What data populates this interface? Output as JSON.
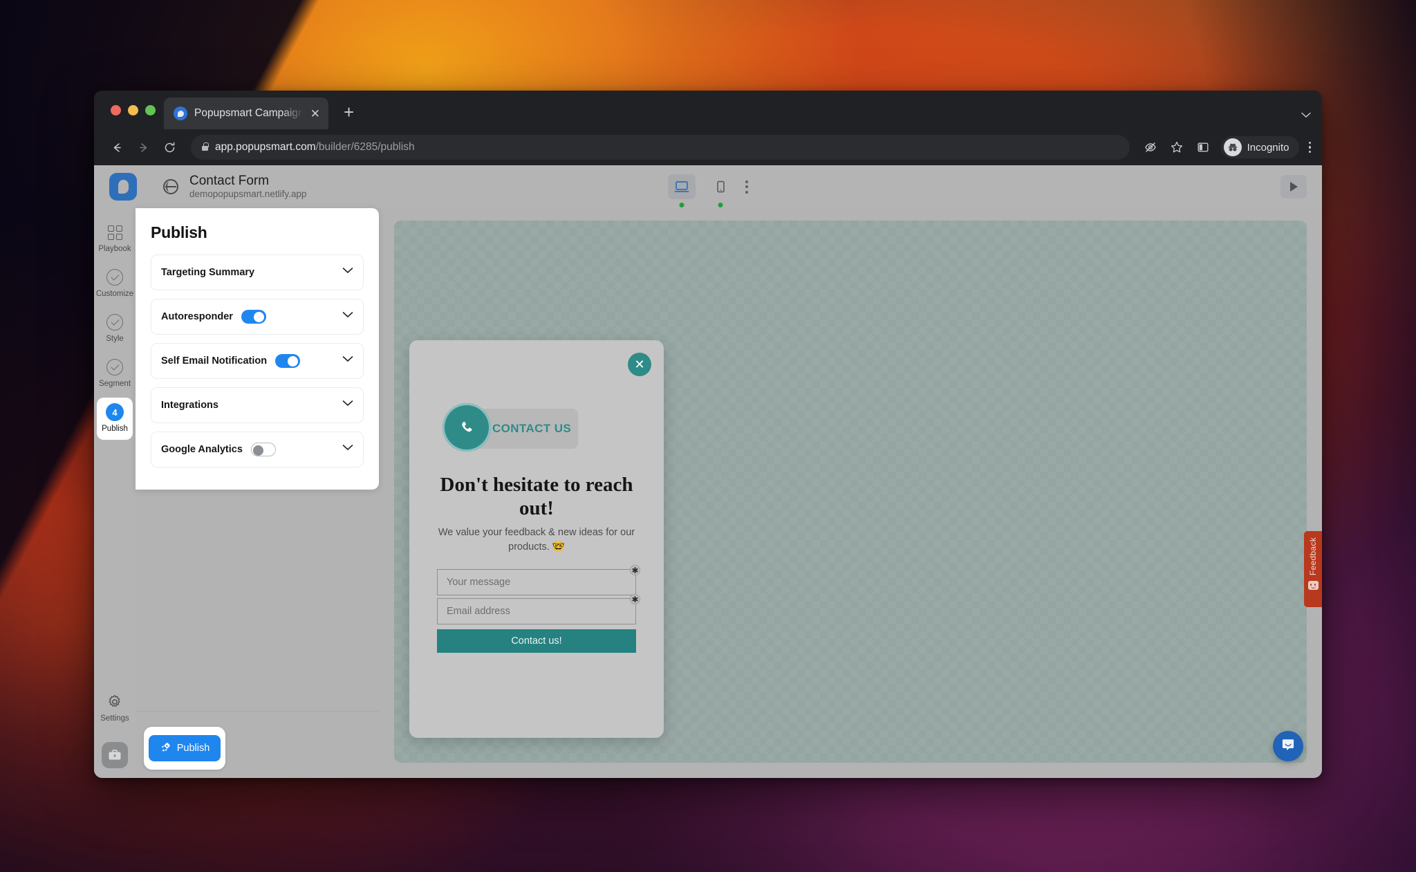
{
  "browser": {
    "tab": {
      "title": "Popupsmart Campaign Builder",
      "favicon_icon": "popupsmart-favicon",
      "close_icon": "close-icon"
    },
    "new_tab_icon": "plus-icon",
    "tabstrip_menu_icon": "chevron-down-icon",
    "nav": {
      "back_icon": "arrow-left-icon",
      "forward_icon": "arrow-right-icon",
      "reload_icon": "reload-icon"
    },
    "omnibox": {
      "lock_icon": "lock-icon",
      "url_host": "app.popupsmart.com",
      "url_path": "/builder/6285/publish"
    },
    "actions": {
      "tracking_protection_icon": "eye-off-icon",
      "bookmark_icon": "star-icon",
      "side_panel_icon": "side-panel-icon",
      "profile_icon": "incognito-avatar-icon",
      "profile_label": "Incognito",
      "menu_icon": "kebab-menu-icon"
    }
  },
  "app": {
    "logo_icon": "popupsmart-logo",
    "site_icon": "globe-icon",
    "campaign_title": "Contact Form",
    "campaign_domain": "demopopupsmart.netlify.app",
    "device_toggles": [
      {
        "name": "desktop",
        "icon": "desktop-icon",
        "active": true,
        "status_dot": "green"
      },
      {
        "name": "mobile",
        "icon": "mobile-icon",
        "active": false,
        "status_dot": "green"
      }
    ],
    "more_icon": "kebab-menu-icon",
    "preview_icon": "play-icon"
  },
  "sidebar": {
    "items": [
      {
        "label": "Playbook",
        "icon": "grid-icon",
        "active": false
      },
      {
        "label": "Customize",
        "icon": "check-circle-icon",
        "active": false
      },
      {
        "label": "Style",
        "icon": "check-circle-icon",
        "active": false
      },
      {
        "label": "Segment",
        "icon": "check-circle-icon",
        "active": false
      },
      {
        "label": "Publish",
        "icon": "step-badge",
        "badge": "4",
        "active": true
      }
    ],
    "settings": {
      "label": "Settings",
      "icon": "gear-icon"
    },
    "workspace_icon": "briefcase-icon"
  },
  "panel": {
    "title": "Publish",
    "sections": [
      {
        "label": "Targeting Summary",
        "toggle": null,
        "chevron_icon": "chevron-down-icon"
      },
      {
        "label": "Autoresponder",
        "toggle": "on",
        "chevron_icon": "chevron-down-icon"
      },
      {
        "label": "Self Email Notification",
        "toggle": "on",
        "chevron_icon": "chevron-down-icon"
      },
      {
        "label": "Integrations",
        "toggle": null,
        "chevron_icon": "chevron-down-icon"
      },
      {
        "label": "Google Analytics",
        "toggle": "off",
        "chevron_icon": "chevron-down-icon"
      }
    ],
    "publish_button": {
      "label": "Publish",
      "icon": "rocket-icon"
    }
  },
  "popup_preview": {
    "close_icon": "close-icon",
    "brand": {
      "icon": "phone-icon",
      "text": "CONTACT US"
    },
    "headline": "Don't hesitate to reach out!",
    "subtext": "We value your feedback & new ideas for our products. 🤓",
    "fields": [
      {
        "placeholder": "Your message",
        "required_mark": "✱"
      },
      {
        "placeholder": "Email address",
        "required_mark": "✱"
      }
    ],
    "cta_label": "Contact us!",
    "accent_color": "#2e8b88"
  },
  "widgets": {
    "feedback": {
      "label": "Feedback",
      "icon": "smiley-face-icon",
      "color": "#b8391e"
    },
    "chat": {
      "icon": "chat-bubble-icon",
      "color": "#2063b8"
    }
  }
}
